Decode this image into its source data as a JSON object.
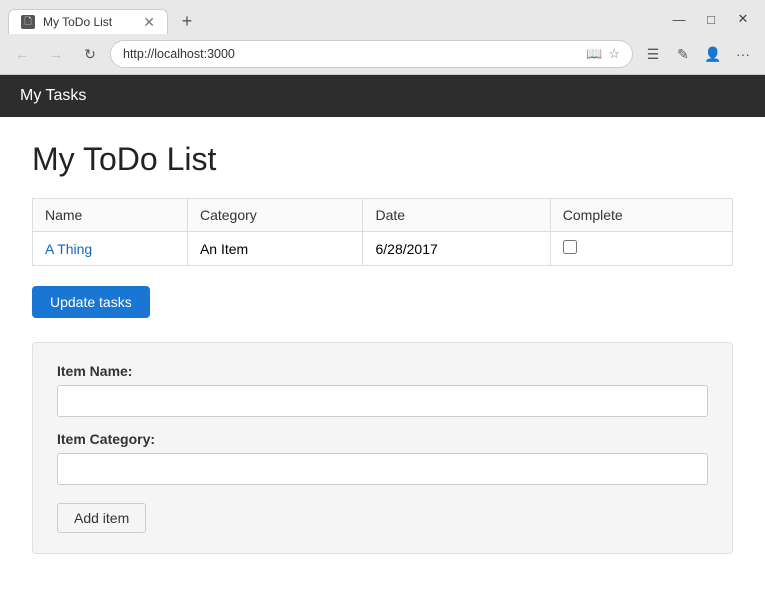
{
  "browser": {
    "tab_title": "My ToDo List",
    "tab_favicon": "📄",
    "new_tab_icon": "+",
    "url": "http://localhost:3000",
    "window_controls": {
      "minimize": "—",
      "maximize": "□",
      "close": "✕"
    },
    "nav": {
      "back": "←",
      "forward": "→",
      "refresh": "↻"
    },
    "address_icons": {
      "reader": "📖",
      "bookmark": "☆",
      "more": "···"
    },
    "toolbar": {
      "favorites": "☰",
      "edit": "✎",
      "profile": "👤",
      "menu": "···"
    }
  },
  "app": {
    "nav_title": "My Tasks",
    "page_title": "My ToDo List",
    "table": {
      "columns": [
        "Name",
        "Category",
        "Date",
        "Complete"
      ],
      "rows": [
        {
          "name": "A Thing",
          "category": "An Item",
          "date": "6/28/2017",
          "complete": false
        }
      ]
    },
    "update_button": "Update tasks",
    "form": {
      "name_label": "Item Name:",
      "name_placeholder": "",
      "category_label": "Item Category:",
      "category_placeholder": "",
      "add_button": "Add item"
    }
  }
}
